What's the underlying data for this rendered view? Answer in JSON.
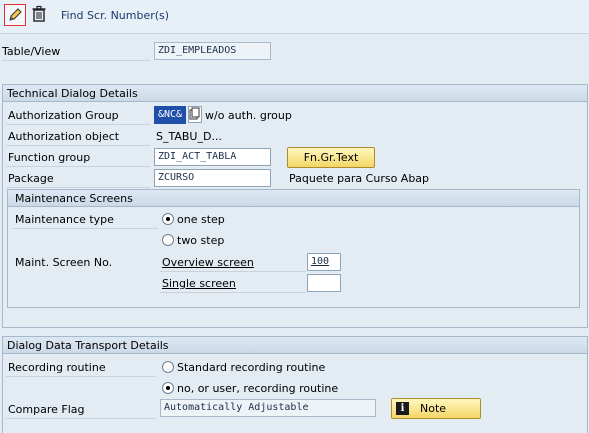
{
  "toolbar": {
    "edit_icon": "pencil-icon",
    "delete_icon": "trash-icon",
    "find_screen_numbers": "Find Scr. Number(s)"
  },
  "table_view": {
    "label": "Table/View",
    "value": "ZDI_EMPLEADOS"
  },
  "technical": {
    "title": "Technical Dialog Details",
    "auth_group": {
      "label": "Authorization Group",
      "value": "&NC&",
      "suffix": "w/o auth. group"
    },
    "auth_object": {
      "label": "Authorization object",
      "value": "S_TABU_D..."
    },
    "function_group": {
      "label": "Function group",
      "value": "ZDI_ACT_TABLA",
      "button": "Fn.Gr.Text"
    },
    "package": {
      "label": "Package",
      "value": "ZCURSO",
      "description": "Paquete para Curso Abap"
    },
    "maint_screens": {
      "title": "Maintenance Screens",
      "type_label": "Maintenance type",
      "one_step": "one step",
      "two_step": "two step",
      "selected": "one step",
      "screen_no_label": "Maint. Screen No.",
      "overview_label": "Overview screen",
      "overview_value": "100",
      "single_label": "Single screen",
      "single_value": ""
    }
  },
  "transport": {
    "title": "Dialog Data Transport Details",
    "recording_label": "Recording routine",
    "standard": "Standard recording routine",
    "no_user": "no, or user, recording routine",
    "selected": "no, or user, recording routine",
    "compare_label": "Compare Flag",
    "compare_value": "Automatically Adjustable",
    "note_button": "Note"
  },
  "colors": {
    "background": "#e3ebf3",
    "selection": "#1f4fa8",
    "button": "#f3d665"
  }
}
